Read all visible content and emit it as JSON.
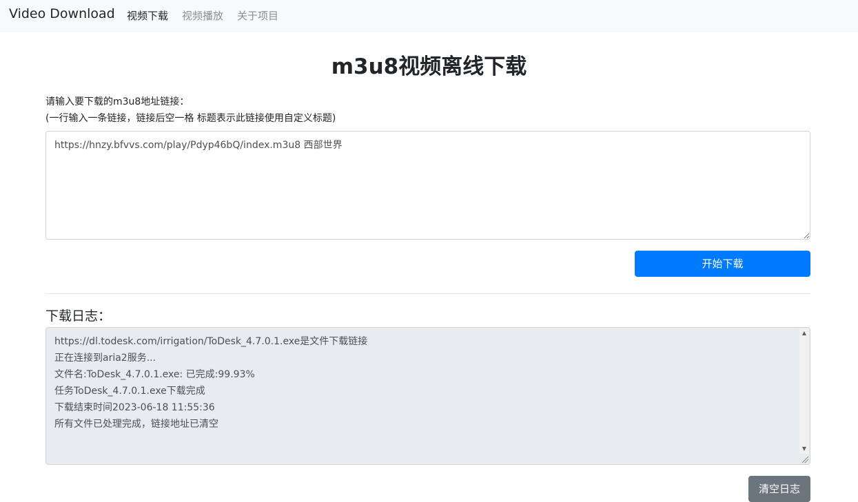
{
  "navbar": {
    "brand": "Video Download",
    "links": [
      {
        "label": "视频下载",
        "active": true
      },
      {
        "label": "视频播放",
        "active": false
      },
      {
        "label": "关于项目",
        "active": false
      }
    ]
  },
  "main": {
    "title": "m3u8视频离线下载",
    "instruction_line1": "请输入要下载的m3u8地址链接：",
    "instruction_line2": "(一行输入一条链接，链接后空一格 标题表示此链接使用自定义标题)",
    "url_input_value": "https://hnzy.bfvvs.com/play/Pdyp46bQ/index.m3u8 西部世界",
    "start_button": "开始下载"
  },
  "log": {
    "heading": "下载日志：",
    "lines": [
      "https://dl.todesk.com/irrigation/ToDesk_4.7.0.1.exe是文件下载链接",
      "正在连接到aria2服务...",
      "文件名:ToDesk_4.7.0.1.exe: 已完成:99.93%",
      "任务ToDesk_4.7.0.1.exe下载完成",
      "下载结束时间2023-06-18 11:55:36",
      "所有文件已处理完成，链接地址已清空"
    ],
    "clear_button": "清空日志"
  },
  "colors": {
    "primary": "#007bff",
    "secondary": "#6c757d",
    "navbar_bg": "#f8f9fa",
    "log_bg": "#e9ecef"
  },
  "icons": {
    "scroll_up": "scroll-up-arrow-icon",
    "scroll_down": "scroll-down-arrow-icon",
    "resize": "resize-grip-icon"
  }
}
